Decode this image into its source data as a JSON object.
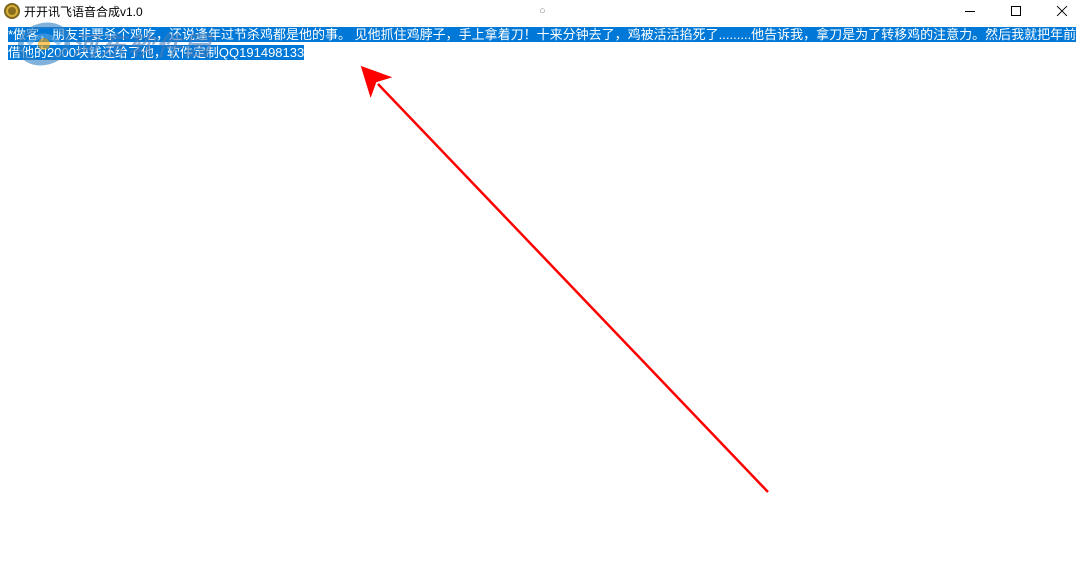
{
  "window": {
    "title": "开开讯飞语音合成v1.0",
    "center_indicator": "○"
  },
  "content": {
    "selected_text": "*做客，朋友非要杀个鸡吃，还说逢年过节杀鸡都是他的事。 见他抓住鸡脖子，手上拿着刀！十来分钟去了，鸡被活活掐死了.........他告诉我，拿刀是为了转移鸡的注意力。然后我就把年前借他的2000块钱还给了他，软件定制QQ191498133"
  },
  "watermark": {
    "text": "河东软件园"
  }
}
